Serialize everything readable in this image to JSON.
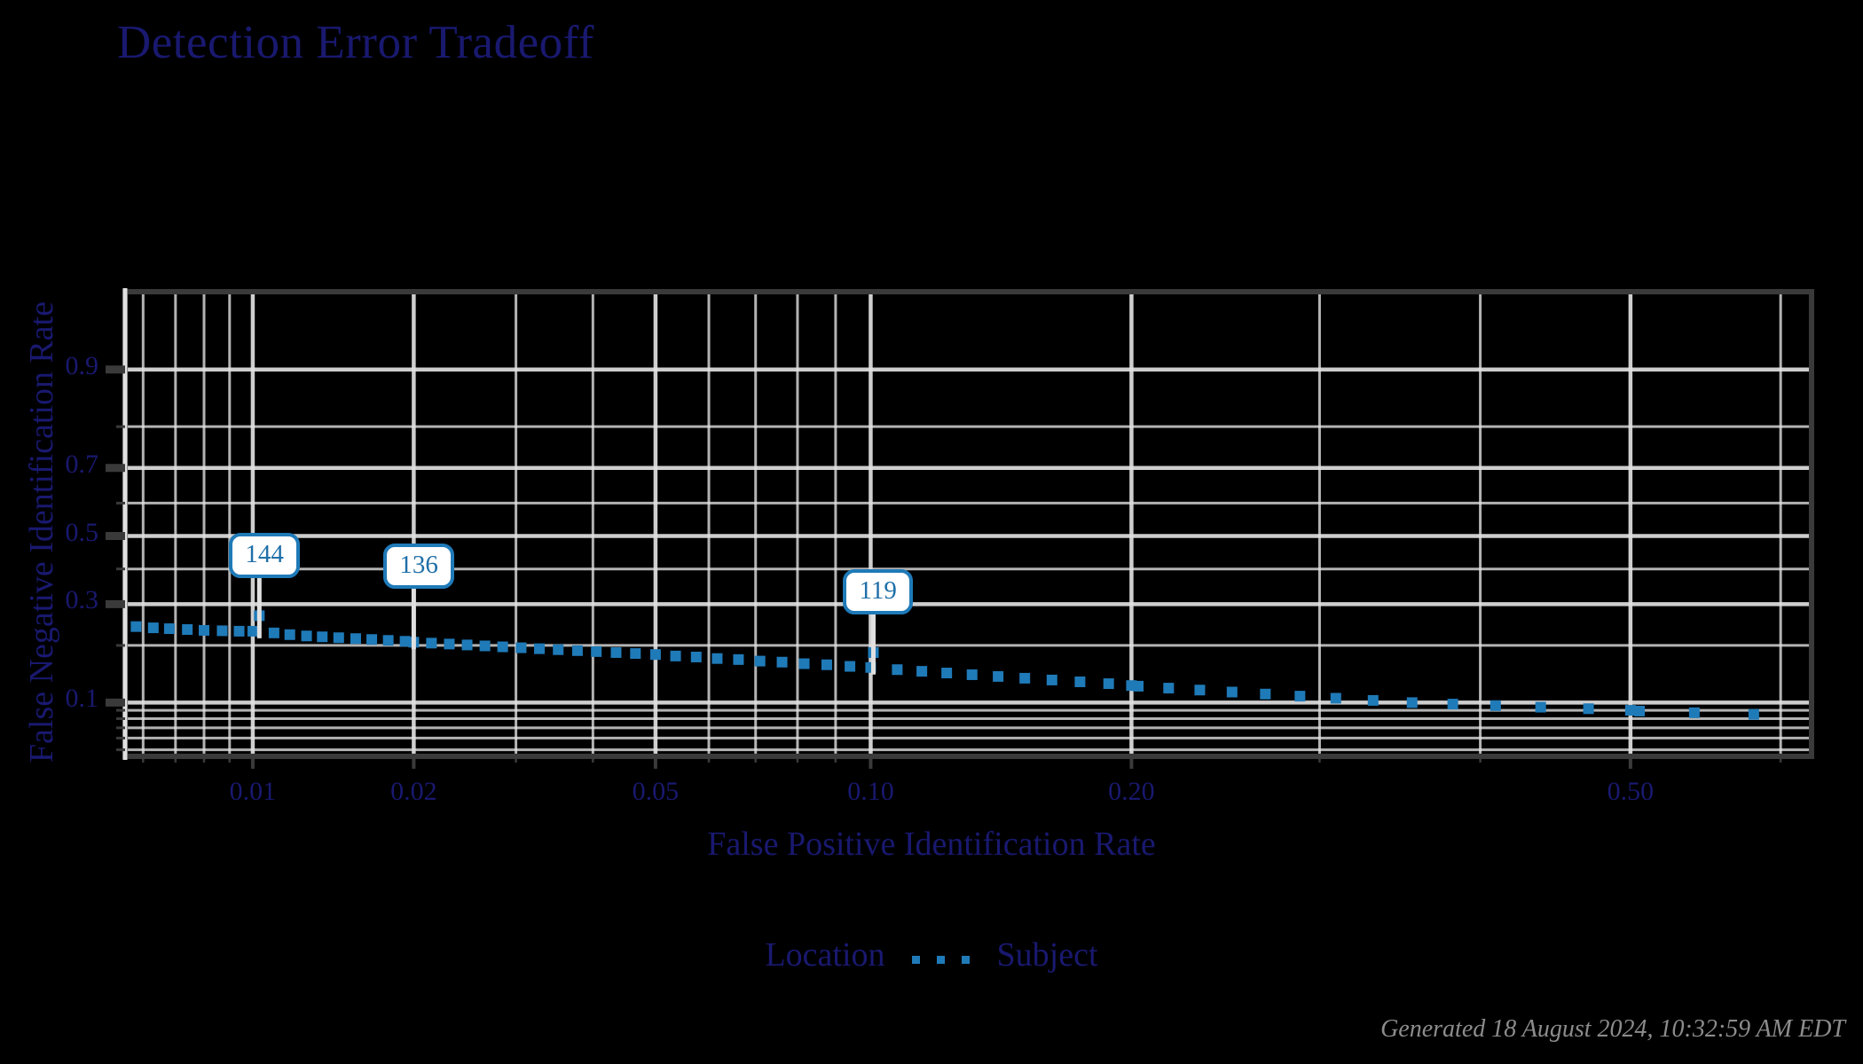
{
  "title": "Detection Error Tradeoff",
  "axes": {
    "x_title": "False Positive Identification Rate",
    "y_title": "False Negative Identification Rate",
    "x_tick_labels": [
      "0.01",
      "0.02",
      "0.05",
      "0.10",
      "0.20",
      "0.50"
    ],
    "y_tick_labels": [
      "0.9",
      "0.7",
      "0.5",
      "0.3",
      "0.1"
    ]
  },
  "legend": {
    "left_label": "Location",
    "right_label": "Subject"
  },
  "callouts": [
    {
      "label": "144"
    },
    {
      "label": "136"
    },
    {
      "label": "119"
    }
  ],
  "footer": "Generated 18 August 2024, 10:32:59 AM EDT",
  "colors": {
    "background": "#000000",
    "text_blue": "#191970",
    "series_blue": "#1f7ab8",
    "grid": "#e0e0e0",
    "axis": "#3a3a3a",
    "footer_gray": "#8c8c8c",
    "callout_fill": "#ffffff"
  },
  "chart_data": {
    "type": "scatter",
    "title": "Detection Error Tradeoff",
    "xlabel": "False Positive Identification Rate",
    "ylabel": "False Negative Identification Rate",
    "xscale": "log-normal-deviate",
    "yscale": "log-normal-deviate",
    "xlim": [
      0.0055,
      0.62
    ],
    "ylim": [
      0.045,
      0.97
    ],
    "xticks": [
      0.01,
      0.02,
      0.05,
      0.1,
      0.2,
      0.5
    ],
    "yticks": [
      0.9,
      0.7,
      0.5,
      0.3,
      0.1
    ],
    "grid": true,
    "legend_position": "bottom",
    "series": [
      {
        "name": "Subject",
        "style": "dotted",
        "color": "#1f7ab8",
        "x": [
          0.0058,
          0.0063,
          0.0068,
          0.0074,
          0.008,
          0.0087,
          0.0094,
          0.01,
          0.0103,
          0.011,
          0.0118,
          0.0127,
          0.0136,
          0.0146,
          0.0157,
          0.0168,
          0.018,
          0.0193,
          0.02,
          0.0215,
          0.0231,
          0.0248,
          0.0266,
          0.0285,
          0.0306,
          0.0328,
          0.0352,
          0.0378,
          0.0405,
          0.0435,
          0.0466,
          0.05,
          0.0536,
          0.0575,
          0.0617,
          0.0662,
          0.071,
          0.0762,
          0.0817,
          0.0876,
          0.094,
          0.1,
          0.1008,
          0.1081,
          0.116,
          0.1244,
          0.1334,
          0.1431,
          0.1535,
          0.1646,
          0.1766,
          0.1894,
          0.2,
          0.2032,
          0.218,
          0.2338,
          0.2508,
          0.269,
          0.2886,
          0.3096,
          0.3321,
          0.3563,
          0.3822,
          0.41,
          0.4398,
          0.4718,
          0.5,
          0.5061,
          0.5429,
          0.5824
        ],
        "y": [
          0.243,
          0.24,
          0.238,
          0.236,
          0.234,
          0.233,
          0.232,
          0.232,
          0.27,
          0.228,
          0.224,
          0.221,
          0.219,
          0.217,
          0.215,
          0.213,
          0.211,
          0.209,
          0.207,
          0.205,
          0.203,
          0.201,
          0.199,
          0.197,
          0.195,
          0.193,
          0.191,
          0.189,
          0.187,
          0.185,
          0.183,
          0.181,
          0.178,
          0.176,
          0.173,
          0.171,
          0.168,
          0.166,
          0.163,
          0.161,
          0.158,
          0.156,
          0.185,
          0.152,
          0.149,
          0.146,
          0.143,
          0.14,
          0.137,
          0.134,
          0.131,
          0.128,
          0.125,
          0.124,
          0.121,
          0.118,
          0.115,
          0.112,
          0.109,
          0.106,
          0.103,
          0.1,
          0.098,
          0.096,
          0.094,
          0.092,
          0.09,
          0.089,
          0.087,
          0.085
        ]
      }
    ],
    "annotations": [
      {
        "label": "144",
        "x": 0.0103,
        "y": 0.232
      },
      {
        "label": "136",
        "x": 0.02,
        "y": 0.207
      },
      {
        "label": "119",
        "x": 0.1008,
        "y": 0.156
      }
    ]
  }
}
